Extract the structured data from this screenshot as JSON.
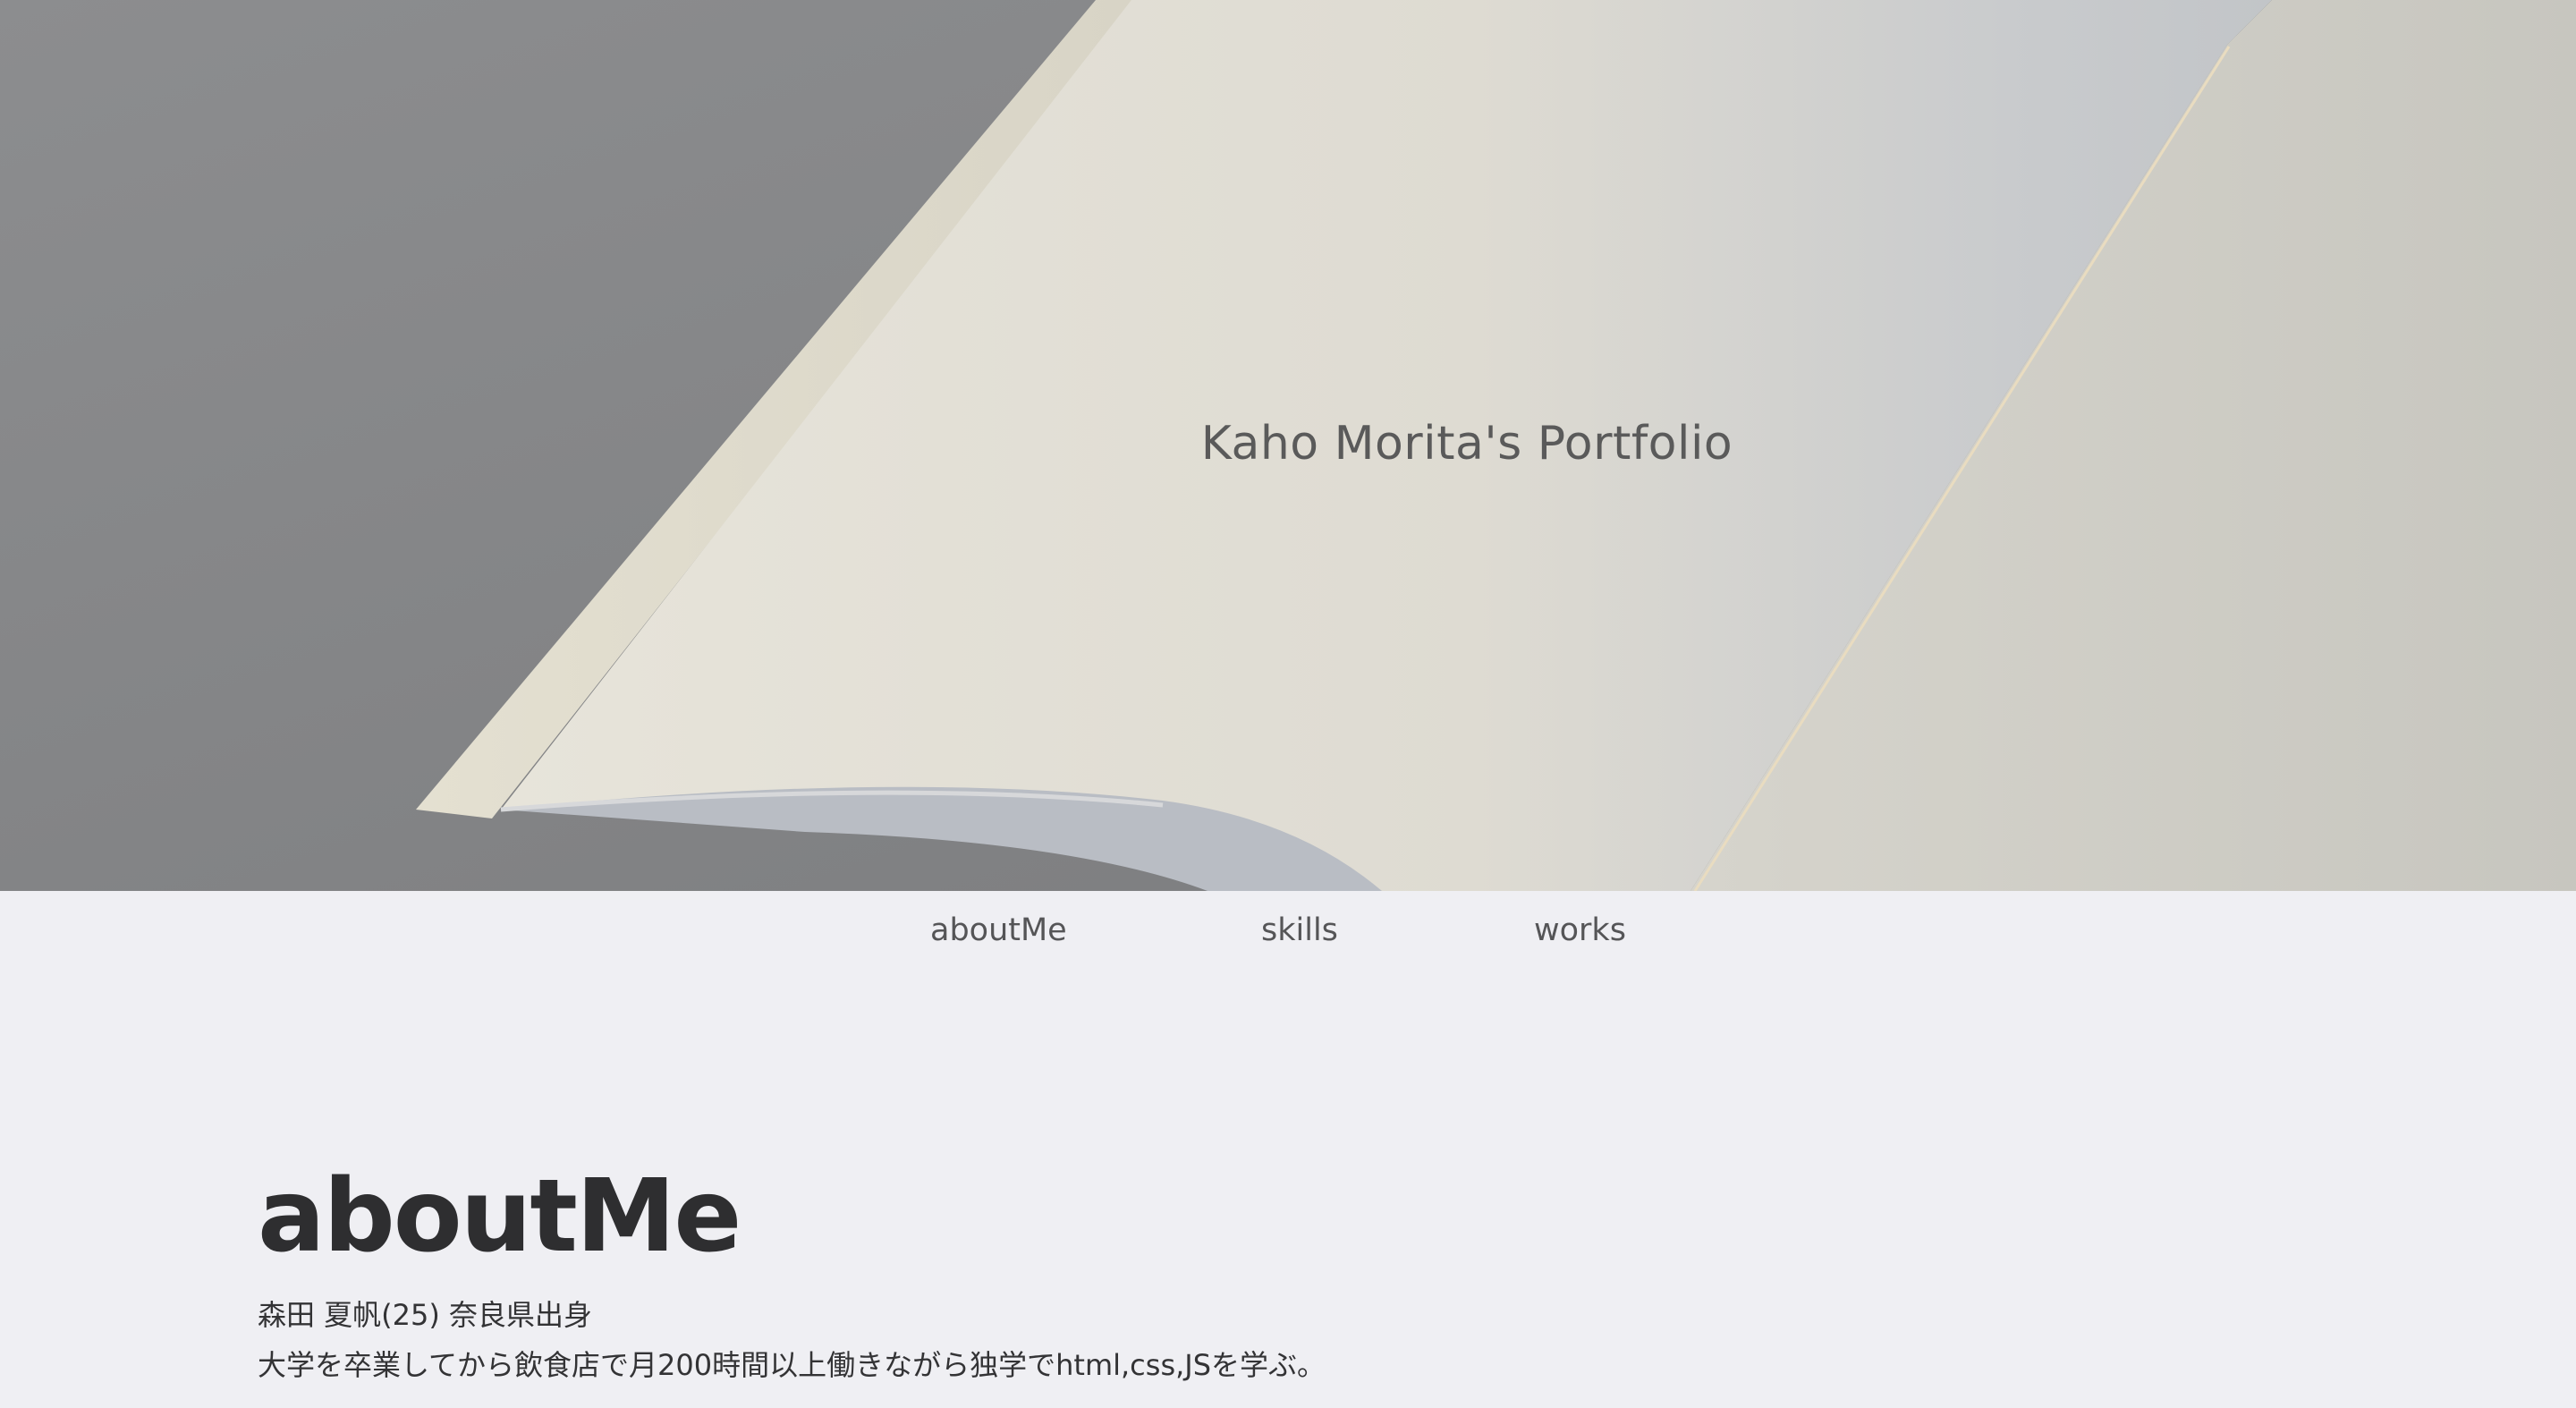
{
  "hero": {
    "title": "Kaho Morita's Portfolio",
    "image": "open-notebook-photo"
  },
  "nav": {
    "items": [
      {
        "label": "aboutMe"
      },
      {
        "label": "skills"
      },
      {
        "label": "works"
      }
    ]
  },
  "about": {
    "heading": "aboutMe",
    "lines": [
      "森田 夏帆(25) 奈良県出身",
      "大学を卒業してから飲食店で月200時間以上働きながら独学でhtml,css,JSを学ぶ。"
    ]
  },
  "colors": {
    "background": "#efeff3",
    "hero_gray": "#808183",
    "paper": "#dcdad2",
    "text_dark": "#2e2e30",
    "text_nav": "#555557"
  }
}
